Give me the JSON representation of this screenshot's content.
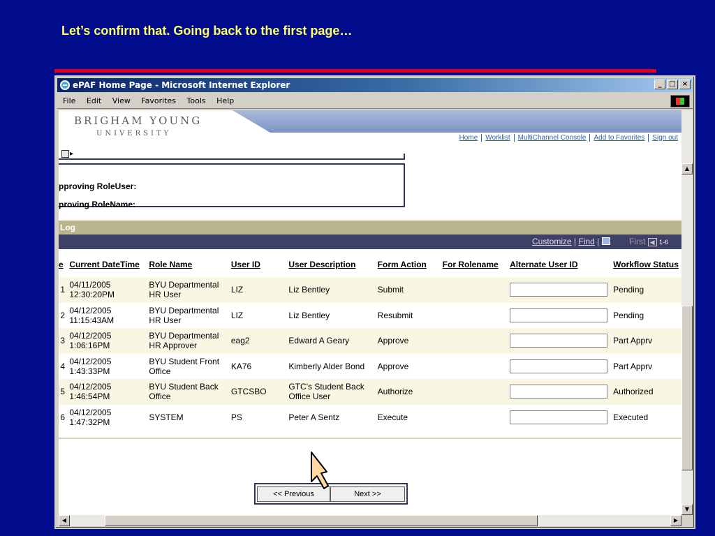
{
  "caption": "Let’s confirm that. Going back to the first page…",
  "window": {
    "title": "ePAF Home Page - Microsoft Internet Explorer",
    "controls": [
      "_",
      "□",
      "×"
    ]
  },
  "menubar": [
    "File",
    "Edit",
    "View",
    "Favorites",
    "Tools",
    "Help"
  ],
  "header": {
    "brand_line1": "BRIGHAM YOUNG",
    "brand_line2": "UNIVERSITY",
    "nav": [
      "Home",
      "Worklist",
      "MultiChannel Console",
      "Add to Favorites",
      "Sign out"
    ]
  },
  "approving": {
    "role_user_label": "pproving RoleUser:",
    "role_name_label": "proving RoleName:"
  },
  "log": {
    "title": "Log",
    "customize": "Customize",
    "find": "Find",
    "first": "First",
    "range": "1-6"
  },
  "grid": {
    "columns": [
      "e",
      "Current DateTime",
      "Role Name",
      "User ID",
      "User Description",
      "Form Action",
      "For Rolename",
      "Alternate User ID",
      "Workflow Status"
    ],
    "rows": [
      {
        "num": "1",
        "datetime1": "04/11/2005",
        "datetime2": "12:30:20PM",
        "role1": "BYU Departmental",
        "role2": "HR User",
        "user_id": "LIZ",
        "desc1": "Liz Bentley",
        "desc2": "",
        "action": "Submit",
        "for_rolename": "",
        "status": "Pending"
      },
      {
        "num": "2",
        "datetime1": "04/12/2005",
        "datetime2": "11:15:43AM",
        "role1": "BYU Departmental",
        "role2": "HR User",
        "user_id": "LIZ",
        "desc1": "Liz Bentley",
        "desc2": "",
        "action": "Resubmit",
        "for_rolename": "",
        "status": "Pending"
      },
      {
        "num": "3",
        "datetime1": "04/12/2005",
        "datetime2": "1:06:16PM",
        "role1": "BYU Departmental",
        "role2": "HR Approver",
        "user_id": "eag2",
        "desc1": "Edward A Geary",
        "desc2": "",
        "action": "Approve",
        "for_rolename": "",
        "status": "Part Apprv"
      },
      {
        "num": "4",
        "datetime1": "04/12/2005",
        "datetime2": "1:43:33PM",
        "role1": "BYU Student Front",
        "role2": "Office",
        "user_id": "KA76",
        "desc1": "Kimberly Alder Bond",
        "desc2": "",
        "action": "Approve",
        "for_rolename": "",
        "status": "Part Apprv"
      },
      {
        "num": "5",
        "datetime1": "04/12/2005",
        "datetime2": "1:46:54PM",
        "role1": "BYU Student Back",
        "role2": "Office",
        "user_id": "GTCSBO",
        "desc1": "GTC's Student Back",
        "desc2": "Office User",
        "action": "Authorize",
        "for_rolename": "",
        "status": "Authorized"
      },
      {
        "num": "6",
        "datetime1": "04/12/2005",
        "datetime2": "1:47:32PM",
        "role1": "SYSTEM",
        "role2": "",
        "user_id": "PS",
        "desc1": "Peter A Sentz",
        "desc2": "",
        "action": "Execute",
        "for_rolename": "",
        "status": "Executed"
      }
    ]
  },
  "pager": {
    "previous": "<< Previous",
    "next": "Next >>"
  }
}
